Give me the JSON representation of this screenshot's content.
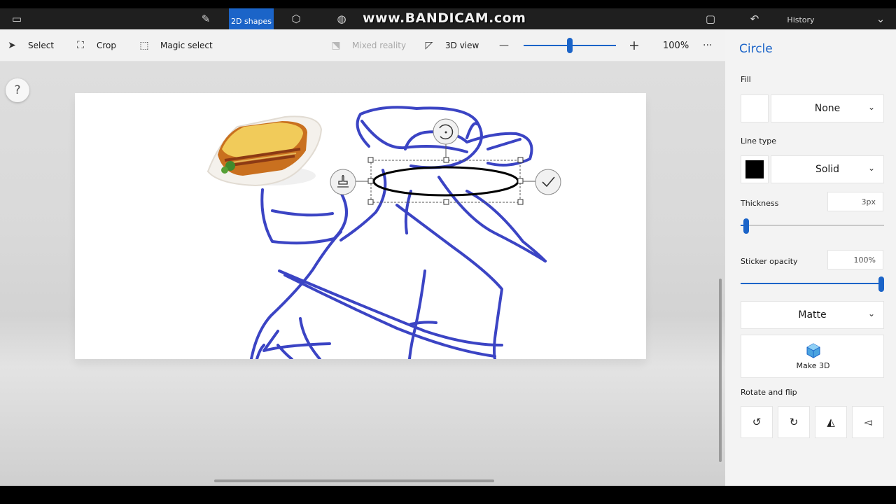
{
  "header": {
    "active_tab": "2D shapes",
    "history": "History",
    "watermark": "www.BANDICAM.com"
  },
  "toolbar": {
    "select": "Select",
    "crop": "Crop",
    "magic_select": "Magic select",
    "mixed_reality": "Mixed reality",
    "view_3d": "3D view",
    "zoom_level": "100%",
    "zoom_minus": "—",
    "zoom_plus": "+",
    "more": "···",
    "zoom_fraction": 0.5
  },
  "canvas": {
    "help": "?"
  },
  "panel": {
    "title": "Circle",
    "fill_label": "Fill",
    "fill_value": "None",
    "line_type_label": "Line type",
    "line_type_value": "Solid",
    "thickness_label": "Thickness",
    "thickness_value": "3px",
    "thickness_fraction": 0.02,
    "sticker_opacity_label": "Sticker opacity",
    "sticker_opacity_value": "100%",
    "sticker_opacity_fraction": 1.0,
    "finish_value": "Matte",
    "make_3d": "Make 3D",
    "rotate_flip_label": "Rotate and flip"
  },
  "colors": {
    "accent": "#1b64c8",
    "drawing_stroke": "#3b44c4",
    "line_color": "#000000"
  }
}
